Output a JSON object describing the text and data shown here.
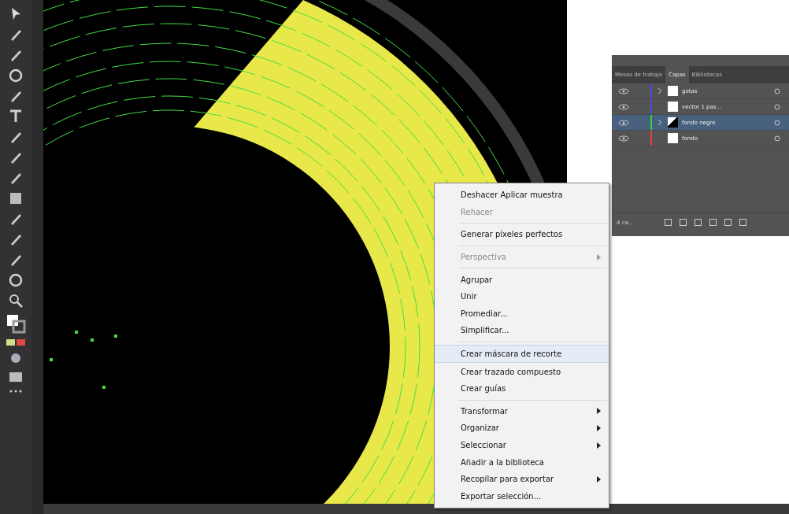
{
  "layers_panel": {
    "tabs": [
      {
        "label": "Mesas de trabajo",
        "selected": false
      },
      {
        "label": "Capas",
        "selected": true
      },
      {
        "label": "Bibliotecas",
        "selected": false
      }
    ],
    "layers": [
      {
        "name": "gotas",
        "color": "#4a4ae0",
        "has_children": true,
        "thumbnail_dark": false,
        "selected": false
      },
      {
        "name": "vector 1 pas...",
        "color": "#4a4ae0",
        "has_children": false,
        "thumbnail_dark": false,
        "selected": false
      },
      {
        "name": "fondo negro",
        "color": "#3ecf3e",
        "has_children": true,
        "thumbnail_dark": true,
        "selected": true
      },
      {
        "name": "fondo",
        "color": "#e04040",
        "has_children": false,
        "thumbnail_dark": false,
        "selected": false
      }
    ],
    "count": "4 ca..."
  },
  "context_menu": {
    "groups": [
      [
        {
          "label": "Deshacer Aplicar muestra",
          "disabled": false,
          "submenu": false,
          "highlighted": false
        },
        {
          "label": "Rehacer",
          "disabled": true,
          "submenu": false,
          "highlighted": false
        }
      ],
      [
        {
          "label": "Generar píxeles perfectos",
          "disabled": false,
          "submenu": false,
          "highlighted": false
        }
      ],
      [
        {
          "label": "Perspectiva",
          "disabled": true,
          "submenu": true,
          "highlighted": false
        }
      ],
      [
        {
          "label": "Agrupar",
          "disabled": false,
          "submenu": false,
          "highlighted": false
        },
        {
          "label": "Unir",
          "disabled": false,
          "submenu": false,
          "highlighted": false
        },
        {
          "label": "Promediar...",
          "disabled": false,
          "submenu": false,
          "highlighted": false
        },
        {
          "label": "Simplificar...",
          "disabled": false,
          "submenu": false,
          "highlighted": false
        }
      ],
      [
        {
          "label": "Crear máscara de recorte",
          "disabled": false,
          "submenu": false,
          "highlighted": true
        },
        {
          "label": "Crear trazado compuesto",
          "disabled": false,
          "submenu": false,
          "highlighted": false
        },
        {
          "label": "Crear guías",
          "disabled": false,
          "submenu": false,
          "highlighted": false
        }
      ],
      [
        {
          "label": "Transformar",
          "disabled": false,
          "submenu": true,
          "highlighted": false
        },
        {
          "label": "Organizar",
          "disabled": false,
          "submenu": true,
          "highlighted": false
        },
        {
          "label": "Seleccionar",
          "disabled": false,
          "submenu": true,
          "highlighted": false
        },
        {
          "label": "Añadir a la biblioteca",
          "disabled": false,
          "submenu": false,
          "highlighted": false
        },
        {
          "label": "Recopilar para exportar",
          "disabled": false,
          "submenu": true,
          "highlighted": false
        },
        {
          "label": "Exportar selección...",
          "disabled": false,
          "submenu": false,
          "highlighted": false
        }
      ]
    ]
  }
}
